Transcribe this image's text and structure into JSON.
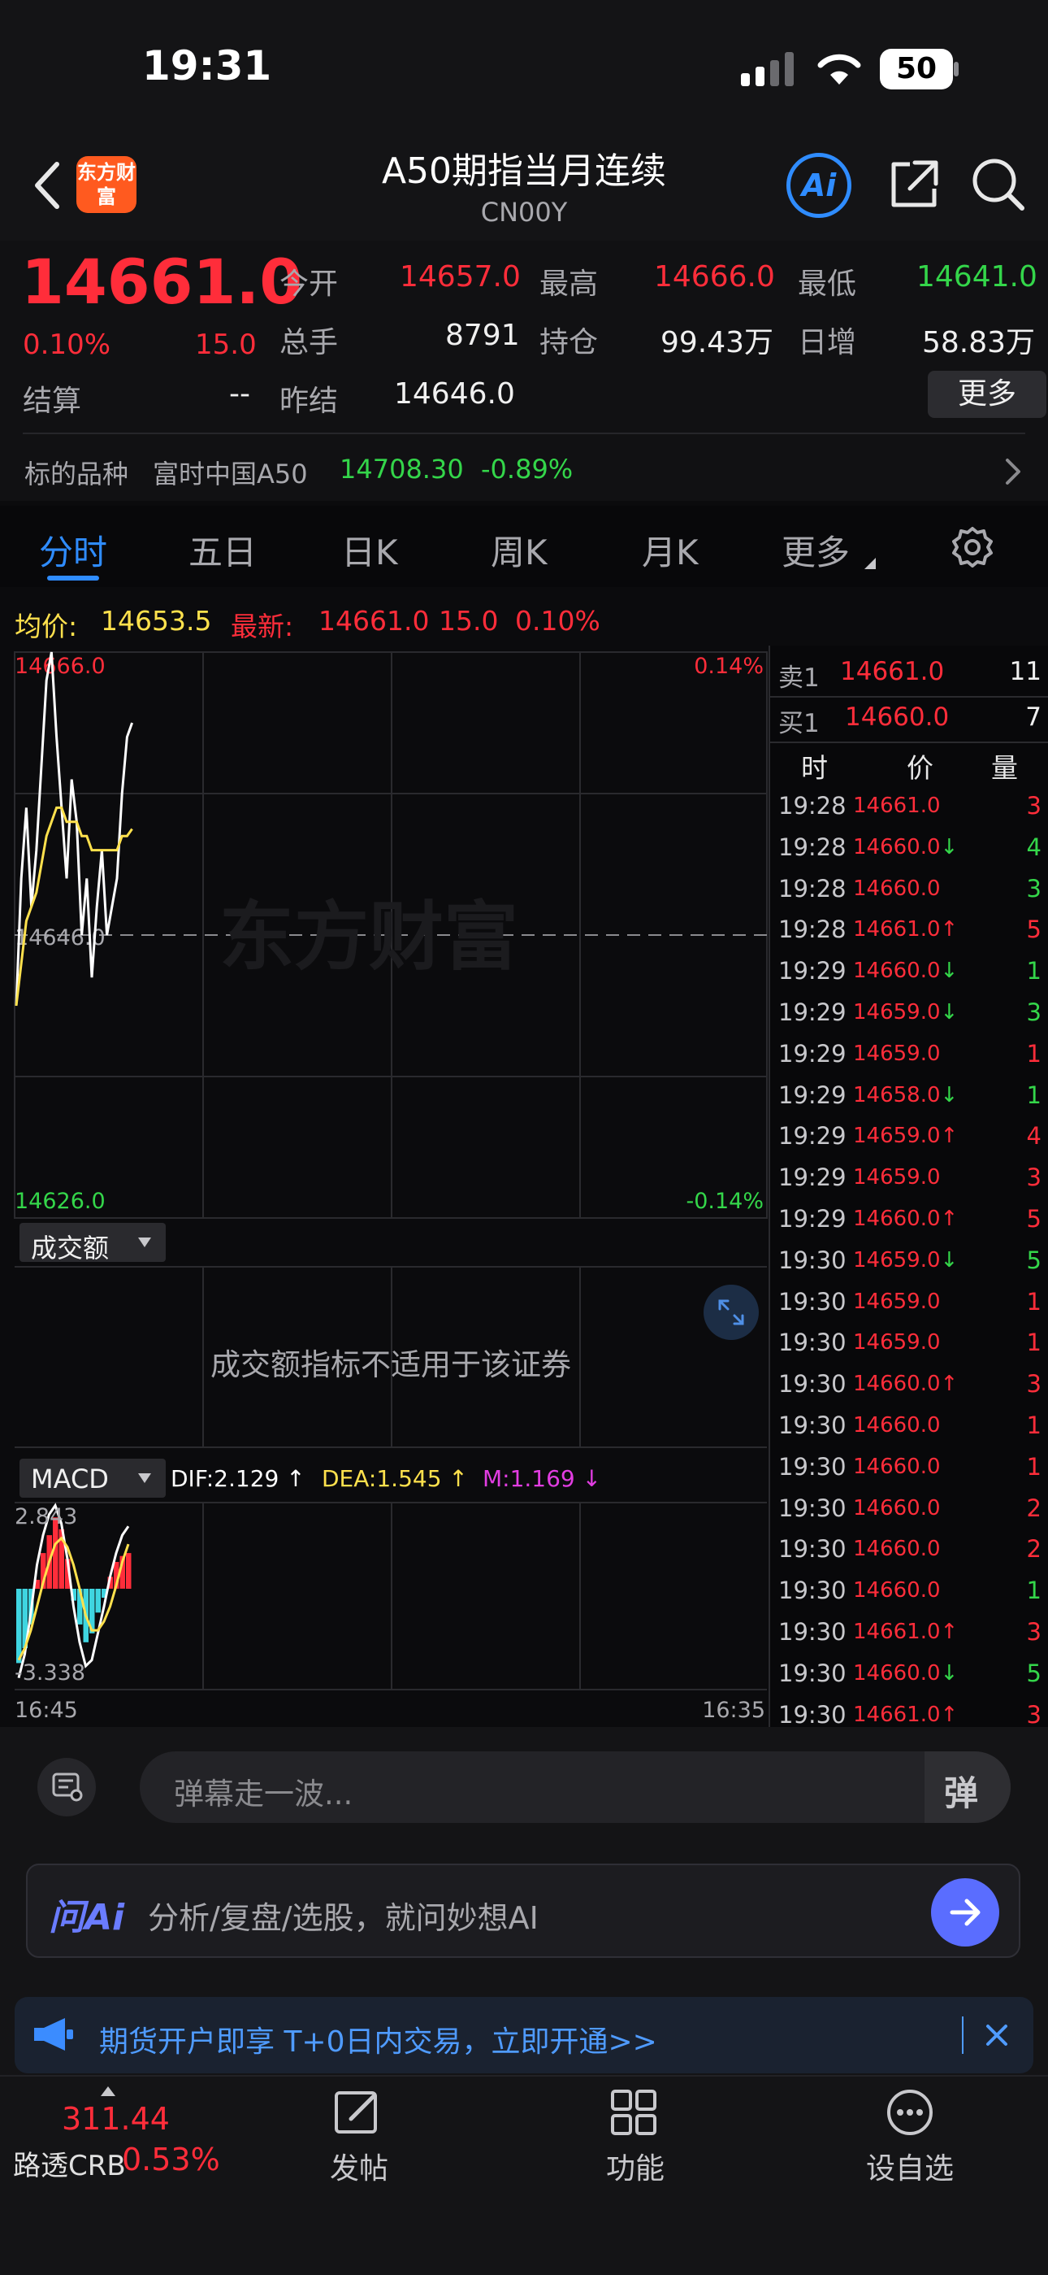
{
  "status_bar": {
    "time": "19:31",
    "battery": "50"
  },
  "header": {
    "back_icon": "chevron-left-icon",
    "logo_text": "东方财富",
    "title": "A50期指当月连续",
    "code": "CN00Y",
    "ai_label": "Ai"
  },
  "quote": {
    "price": "14661.0",
    "pct": "0.10%",
    "change": "15.0",
    "settle_label": "结算",
    "settle_value": "--",
    "open_label": "今开",
    "open_value": "14657.0",
    "high_label": "最高",
    "high_value": "14666.0",
    "low_label": "最低",
    "low_value": "14641.0",
    "volume_label": "总手",
    "volume_value": "8791",
    "oi_label": "持仓",
    "oi_value": "99.43万",
    "daily_inc_label": "日增",
    "daily_inc_value": "58.83万",
    "prev_settle_label": "昨结",
    "prev_settle_value": "14646.0",
    "more_label": "更多"
  },
  "underlying": {
    "label": "标的品种",
    "name": "富时中国A50",
    "price": "14708.30",
    "pct": "-0.89%"
  },
  "tabs": [
    "分时",
    "五日",
    "日K",
    "周K",
    "月K",
    "更多"
  ],
  "active_tab": 0,
  "chart_info": {
    "avg_label": "均价:",
    "avg_value": "14653.5",
    "latest_label": "最新:",
    "latest_value": "14661.0",
    "latest_change": "15.0",
    "latest_pct": "0.10%"
  },
  "chart_data": {
    "type": "line",
    "title": "",
    "ylim": [
      14626.0,
      14666.0
    ],
    "y_top_label": "14666.0",
    "y_mid_label": "14646.0",
    "y_bottom_label": "14626.0",
    "pct_top_label": "0.14%",
    "pct_bottom_label": "-0.14%",
    "x_start_label": "16:45",
    "x_end_label": "16:35",
    "series": [
      {
        "name": "",
        "values": [
          14641,
          14650,
          14655,
          14648,
          14652,
          14658,
          14664,
          14666,
          14660,
          14655,
          14650,
          14657,
          14654,
          14646,
          14650,
          14643,
          14648,
          14652,
          14646,
          14648,
          14650,
          14656,
          14660,
          14661
        ]
      },
      {
        "name": "",
        "values": [
          14641,
          14644,
          14647,
          14648,
          14649,
          14651,
          14653,
          14654,
          14655,
          14655,
          14654,
          14654,
          14654,
          14653,
          14653,
          14652,
          14652,
          14652,
          14652,
          14652,
          14652,
          14653,
          14653,
          14653.5
        ]
      }
    ],
    "macd": {
      "selector_label": "MACD",
      "dif_label": "DIF:2.129 ↑",
      "dea_label": "DEA:1.545 ↑",
      "m_label": "M:1.169 ↓",
      "top_label": "2.843",
      "bottom_label": "-3.338",
      "ylim": [
        -3.338,
        2.843
      ],
      "hist": [
        -2.5,
        -2.0,
        -1.2,
        0.3,
        1.2,
        1.8,
        2.4,
        2.0,
        1.0,
        -0.4,
        -1.2,
        -1.8,
        -1.5,
        -0.8,
        -0.3,
        0.4,
        0.9,
        1.1,
        1.2
      ],
      "dif": [
        -3.0,
        -2.2,
        -0.8,
        0.8,
        1.8,
        2.5,
        2.8,
        2.2,
        1.0,
        -0.6,
        -1.8,
        -2.6,
        -2.4,
        -1.5,
        -0.6,
        0.4,
        1.2,
        1.8,
        2.1
      ],
      "dea": [
        -2.4,
        -2.0,
        -1.4,
        -0.6,
        0.2,
        0.9,
        1.5,
        1.7,
        1.4,
        0.8,
        0.0,
        -0.9,
        -1.4,
        -1.4,
        -1.1,
        -0.6,
        0.1,
        0.9,
        1.5
      ]
    },
    "volume_panel": {
      "selector_label": "成交额",
      "message": "成交额指标不适用于该证券"
    },
    "watermark": "东方财富"
  },
  "orderbook": {
    "sell_label": "卖1",
    "sell_price": "14661.0",
    "sell_qty": "11",
    "buy_label": "买1",
    "buy_price": "14660.0",
    "buy_qty": "7",
    "col_time": "时",
    "col_price": "价",
    "col_qty": "量",
    "ticks": [
      {
        "time": "19:28",
        "price": "14661.0",
        "arrow": "",
        "qty": "3",
        "dir": "up"
      },
      {
        "time": "19:28",
        "price": "14660.0↓",
        "arrow": "",
        "qty": "4",
        "dir": "down"
      },
      {
        "time": "19:28",
        "price": "14660.0",
        "arrow": "",
        "qty": "3",
        "dir": "down"
      },
      {
        "time": "19:28",
        "price": "14661.0↑",
        "arrow": "",
        "qty": "5",
        "dir": "up"
      },
      {
        "time": "19:29",
        "price": "14660.0↓",
        "arrow": "",
        "qty": "1",
        "dir": "down"
      },
      {
        "time": "19:29",
        "price": "14659.0↓",
        "arrow": "",
        "qty": "3",
        "dir": "down"
      },
      {
        "time": "19:29",
        "price": "14659.0",
        "arrow": "",
        "qty": "1",
        "dir": "up"
      },
      {
        "time": "19:29",
        "price": "14658.0↓",
        "arrow": "",
        "qty": "1",
        "dir": "down"
      },
      {
        "time": "19:29",
        "price": "14659.0↑",
        "arrow": "",
        "qty": "4",
        "dir": "up"
      },
      {
        "time": "19:29",
        "price": "14659.0",
        "arrow": "",
        "qty": "3",
        "dir": "up"
      },
      {
        "time": "19:29",
        "price": "14660.0↑",
        "arrow": "",
        "qty": "5",
        "dir": "up"
      },
      {
        "time": "19:30",
        "price": "14659.0↓",
        "arrow": "",
        "qty": "5",
        "dir": "down"
      },
      {
        "time": "19:30",
        "price": "14659.0",
        "arrow": "",
        "qty": "1",
        "dir": "up"
      },
      {
        "time": "19:30",
        "price": "14659.0",
        "arrow": "",
        "qty": "1",
        "dir": "up"
      },
      {
        "time": "19:30",
        "price": "14660.0↑",
        "arrow": "",
        "qty": "3",
        "dir": "up"
      },
      {
        "time": "19:30",
        "price": "14660.0",
        "arrow": "",
        "qty": "1",
        "dir": "up"
      },
      {
        "time": "19:30",
        "price": "14660.0",
        "arrow": "",
        "qty": "1",
        "dir": "up"
      },
      {
        "time": "19:30",
        "price": "14660.0",
        "arrow": "",
        "qty": "2",
        "dir": "up"
      },
      {
        "time": "19:30",
        "price": "14660.0",
        "arrow": "",
        "qty": "2",
        "dir": "up"
      },
      {
        "time": "19:30",
        "price": "14660.0",
        "arrow": "",
        "qty": "1",
        "dir": "down"
      },
      {
        "time": "19:30",
        "price": "14661.0↑",
        "arrow": "",
        "qty": "3",
        "dir": "up"
      },
      {
        "time": "19:30",
        "price": "14660.0↓",
        "arrow": "",
        "qty": "5",
        "dir": "down"
      },
      {
        "time": "19:30",
        "price": "14661.0↑",
        "arrow": "",
        "qty": "3",
        "dir": "up"
      }
    ]
  },
  "danmaku": {
    "placeholder": "弹幕走一波...",
    "button": "弹"
  },
  "ai_bar": {
    "logo": "问Ai",
    "placeholder": "分析/复盘/选股，就问妙想AI"
  },
  "promo": {
    "text": "期货开户即享 T+0日内交易，立即开通>>"
  },
  "bottom_nav": {
    "ticker_value": "311.44",
    "ticker_name": "路透CRB",
    "ticker_pct": "0.53%",
    "post_label": "发帖",
    "func_label": "功能",
    "watch_label": "设自选"
  },
  "colors": {
    "up": "#ff2d3a",
    "down": "#34d64a",
    "accent": "#2f8cff",
    "avg_line": "#ffe14d"
  }
}
